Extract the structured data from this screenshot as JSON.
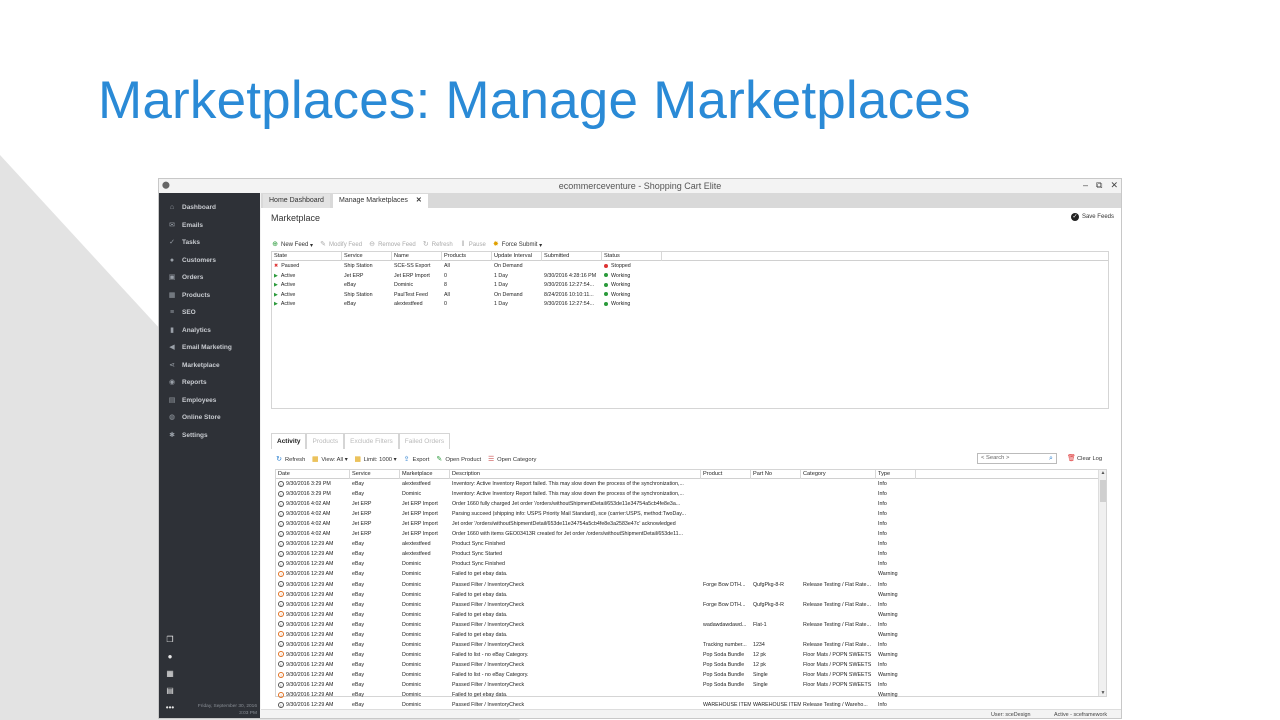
{
  "slide": {
    "title": "Marketplaces: Manage Marketplaces"
  },
  "window": {
    "title": "ecommerceventure - Shopping Cart Elite",
    "controls": [
      "–",
      "⧉",
      "✕"
    ]
  },
  "sidebar": {
    "items": [
      {
        "label": "Dashboard",
        "icon": "home-icon"
      },
      {
        "label": "Emails",
        "icon": "envelope-icon"
      },
      {
        "label": "Tasks",
        "icon": "tasks-icon"
      },
      {
        "label": "Customers",
        "icon": "user-icon"
      },
      {
        "label": "Orders",
        "icon": "cart-icon"
      },
      {
        "label": "Products",
        "icon": "box-icon"
      },
      {
        "label": "SEO",
        "icon": "seo-icon"
      },
      {
        "label": "Analytics",
        "icon": "bar-chart-icon"
      },
      {
        "label": "Email Marketing",
        "icon": "megaphone-icon"
      },
      {
        "label": "Marketplace",
        "icon": "share-icon"
      },
      {
        "label": "Reports",
        "icon": "reports-icon"
      },
      {
        "label": "Employees",
        "icon": "employees-icon"
      },
      {
        "label": "Online Store",
        "icon": "globe-icon"
      },
      {
        "label": "Settings",
        "icon": "gear-icon"
      }
    ],
    "footer_date": "Friday, September 30, 2016",
    "footer_time": "3:03 PM"
  },
  "tabs": {
    "home": "Home Dashboard",
    "manage": "Manage Marketplaces",
    "close": "✕"
  },
  "marketplace": {
    "title": "Marketplace",
    "save_feeds": "Save Feeds",
    "toolbar": {
      "new_feed": "New Feed",
      "modify_feed": "Modify Feed",
      "remove_feed": "Remove Feed",
      "refresh": "Refresh",
      "pause": "Pause",
      "force_submit": "Force Submit"
    },
    "columns": [
      "State",
      "Service",
      "Name",
      "Products",
      "Update Interval",
      "Submitted",
      "Status"
    ],
    "rows": [
      {
        "state": "Paused",
        "service": "Ship Station",
        "name": "SCE-SS Export",
        "products": "All",
        "interval": "On Demand",
        "submitted": "",
        "status": "Stopped"
      },
      {
        "state": "Active",
        "service": "Jet ERP",
        "name": "Jet ERP Import",
        "products": "0",
        "interval": "1 Day",
        "submitted": "9/30/2016 4:28:16 PM",
        "status": "Working"
      },
      {
        "state": "Active",
        "service": "eBay",
        "name": "Dominic",
        "products": "8",
        "interval": "1 Day",
        "submitted": "9/30/2016 12:27:54...",
        "status": "Working"
      },
      {
        "state": "Active",
        "service": "Ship Station",
        "name": "PaulTest Feed",
        "products": "All",
        "interval": "On Demand",
        "submitted": "8/24/2016 10:10:11...",
        "status": "Working"
      },
      {
        "state": "Active",
        "service": "eBay",
        "name": "alextestfeed",
        "products": "0",
        "interval": "1 Day",
        "submitted": "9/30/2016 12:27:54...",
        "status": "Working"
      }
    ]
  },
  "subtabs": [
    "Activity",
    "Products",
    "Exclude Filters",
    "Failed Orders"
  ],
  "activity": {
    "toolbar": {
      "refresh": "Refresh",
      "view": "View: All",
      "limit": "Limit: 1000",
      "export": "Export",
      "open_product": "Open Product",
      "open_category": "Open Category",
      "clear_log": "Clear Log"
    },
    "search_placeholder": "< Search >",
    "columns": [
      "Date",
      "Service",
      "Marketplace",
      "Description",
      "Product",
      "Part No",
      "Category",
      "Type"
    ],
    "rows": [
      {
        "kind": "info",
        "date": "9/30/2016 3:29 PM",
        "service": "eBay",
        "marketplace": "alextestfeed",
        "description": "Inventory: Active Inventory Report failed. This may slow down the process of the synchronization,...",
        "product": "",
        "part": "",
        "category": "",
        "type": "Info"
      },
      {
        "kind": "info",
        "date": "9/30/2016 3:29 PM",
        "service": "eBay",
        "marketplace": "Dominic",
        "description": "Inventory: Active Inventory Report failed. This may slow down the process of the synchronization,...",
        "product": "",
        "part": "",
        "category": "",
        "type": "Info"
      },
      {
        "kind": "info",
        "date": "9/30/2016 4:02 AM",
        "service": "Jet ERP",
        "marketplace": "Jet ERP Import",
        "description": "Order 1660 fully charged Jet order '/orders/withoutShipmentDetail/653de11e34754a5cb4fe8e3a...",
        "product": "",
        "part": "",
        "category": "",
        "type": "Info"
      },
      {
        "kind": "info",
        "date": "9/30/2016 4:02 AM",
        "service": "Jet ERP",
        "marketplace": "Jet ERP Import",
        "description": "Parsing succeed (shipping info: USPS Priority Mail Standard), sce (carrier:USPS, method:TwoDay...",
        "product": "",
        "part": "",
        "category": "",
        "type": "Info"
      },
      {
        "kind": "info",
        "date": "9/30/2016 4:02 AM",
        "service": "Jet ERP",
        "marketplace": "Jet ERP Import",
        "description": "Jet order '/orders/withoutShipmentDetail/653de11e34754a5cb4fe8e3a2583e47c' acknowledged",
        "product": "",
        "part": "",
        "category": "",
        "type": "Info"
      },
      {
        "kind": "info",
        "date": "9/30/2016 4:02 AM",
        "service": "Jet ERP",
        "marketplace": "Jet ERP Import",
        "description": "Order 1660 with items GEO03413R created for Jet order /orders/withoutShipmentDetail/653de11...",
        "product": "",
        "part": "",
        "category": "",
        "type": "Info"
      },
      {
        "kind": "info",
        "date": "9/30/2016 12:29 AM",
        "service": "eBay",
        "marketplace": "alextestfeed",
        "description": "Product Sync Finished",
        "product": "",
        "part": "",
        "category": "",
        "type": "Info"
      },
      {
        "kind": "info",
        "date": "9/30/2016 12:29 AM",
        "service": "eBay",
        "marketplace": "alextestfeed",
        "description": "Product Sync Started",
        "product": "",
        "part": "",
        "category": "",
        "type": "Info"
      },
      {
        "kind": "info",
        "date": "9/30/2016 12:29 AM",
        "service": "eBay",
        "marketplace": "Dominic",
        "description": "Product Sync Finished",
        "product": "",
        "part": "",
        "category": "",
        "type": "Info"
      },
      {
        "kind": "warn",
        "date": "9/30/2016 12:29 AM",
        "service": "eBay",
        "marketplace": "Dominic",
        "description": "Failed to get ebay data.",
        "product": "",
        "part": "",
        "category": "",
        "type": "Warning"
      },
      {
        "kind": "info",
        "date": "9/30/2016 12:29 AM",
        "service": "eBay",
        "marketplace": "Dominic",
        "description": "Passed Filter / InventoryCheck",
        "product": "Forge Bow DTH...",
        "part": "QufgPkg-8-R",
        "category": "Release Testing / Flat Rate...",
        "type": "Info"
      },
      {
        "kind": "warn",
        "date": "9/30/2016 12:29 AM",
        "service": "eBay",
        "marketplace": "Dominic",
        "description": "Failed to get ebay data.",
        "product": "",
        "part": "",
        "category": "",
        "type": "Warning"
      },
      {
        "kind": "info",
        "date": "9/30/2016 12:29 AM",
        "service": "eBay",
        "marketplace": "Dominic",
        "description": "Passed Filter / InventoryCheck",
        "product": "Forge Bow DTH...",
        "part": "QufgPkg-8-R",
        "category": "Release Testing / Flat Rate...",
        "type": "Info"
      },
      {
        "kind": "warn",
        "date": "9/30/2016 12:29 AM",
        "service": "eBay",
        "marketplace": "Dominic",
        "description": "Failed to get ebay data.",
        "product": "",
        "part": "",
        "category": "",
        "type": "Warning"
      },
      {
        "kind": "info",
        "date": "9/30/2016 12:29 AM",
        "service": "eBay",
        "marketplace": "Dominic",
        "description": "Passed Filter / InventoryCheck",
        "product": "wadawdawdawd...",
        "part": "Flat-1",
        "category": "Release Testing / Flat Rate...",
        "type": "Info"
      },
      {
        "kind": "warn",
        "date": "9/30/2016 12:29 AM",
        "service": "eBay",
        "marketplace": "Dominic",
        "description": "Failed to get ebay data.",
        "product": "",
        "part": "",
        "category": "",
        "type": "Warning"
      },
      {
        "kind": "info",
        "date": "9/30/2016 12:29 AM",
        "service": "eBay",
        "marketplace": "Dominic",
        "description": "Passed Filter / InventoryCheck",
        "product": "Tracking number...",
        "part": "1234",
        "category": "Release Testing / Flat Rate...",
        "type": "Info"
      },
      {
        "kind": "warn",
        "date": "9/30/2016 12:29 AM",
        "service": "eBay",
        "marketplace": "Dominic",
        "description": "Failed to list - no eBay Category.",
        "product": "Pop Soda Bundle",
        "part": "12 pk",
        "category": "Floor Mats / POPN SWEETS",
        "type": "Warning"
      },
      {
        "kind": "info",
        "date": "9/30/2016 12:29 AM",
        "service": "eBay",
        "marketplace": "Dominic",
        "description": "Passed Filter / InventoryCheck",
        "product": "Pop Soda Bundle",
        "part": "12 pk",
        "category": "Floor Mats / POPN SWEETS",
        "type": "Info"
      },
      {
        "kind": "warn",
        "date": "9/30/2016 12:29 AM",
        "service": "eBay",
        "marketplace": "Dominic",
        "description": "Failed to list - no eBay Category.",
        "product": "Pop Soda Bundle",
        "part": "Single",
        "category": "Floor Mats / POPN SWEETS",
        "type": "Warning"
      },
      {
        "kind": "info",
        "date": "9/30/2016 12:29 AM",
        "service": "eBay",
        "marketplace": "Dominic",
        "description": "Passed Filter / InventoryCheck",
        "product": "Pop Soda Bundle",
        "part": "Single",
        "category": "Floor Mats / POPN SWEETS",
        "type": "Info"
      },
      {
        "kind": "warn",
        "date": "9/30/2016 12:29 AM",
        "service": "eBay",
        "marketplace": "Dominic",
        "description": "Failed to get ebay data.",
        "product": "",
        "part": "",
        "category": "",
        "type": "Warning"
      },
      {
        "kind": "info",
        "date": "9/30/2016 12:29 AM",
        "service": "eBay",
        "marketplace": "Dominic",
        "description": "Passed Filter / InventoryCheck",
        "product": "WAREHOUSE ITEM",
        "part": "WAREHOUSE ITEM",
        "category": "Release Testing / Wareho...",
        "type": "Info"
      }
    ]
  },
  "statusbar": {
    "user": "User: sceDesign",
    "active": "Active - sceframework"
  },
  "colors": {
    "title_blue": "#2a8ad6",
    "sidebar_bg": "#2e3137",
    "active_green": "#2a9a3a",
    "stopped_red": "#d33",
    "warning_orange": "#e07020"
  }
}
